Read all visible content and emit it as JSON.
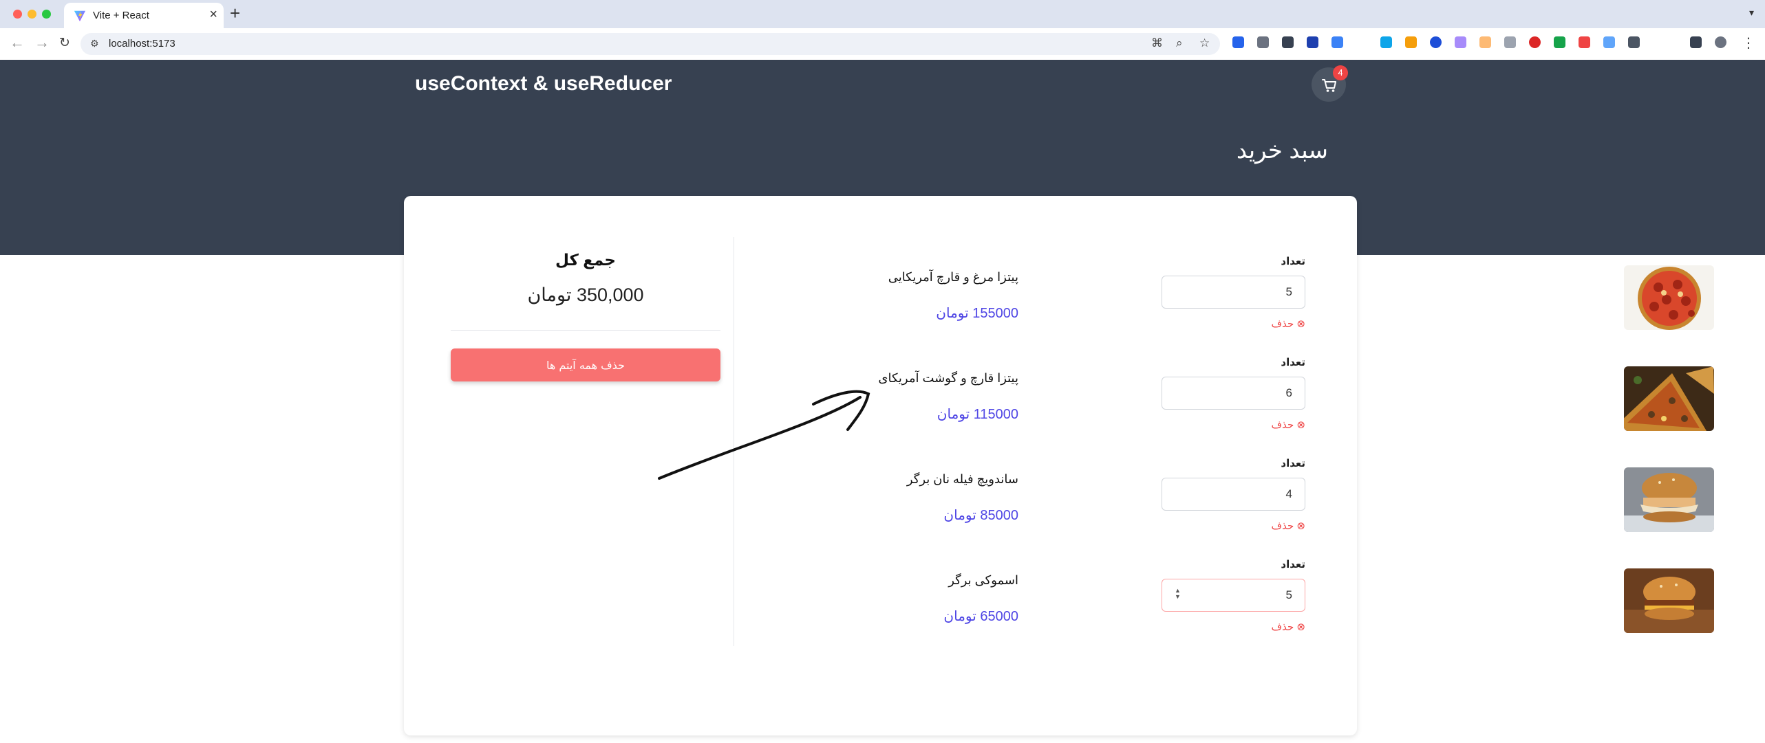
{
  "browser": {
    "tab_title": "Vite + React",
    "url": "localhost:5173"
  },
  "header": {
    "brand": "useContext & useReducer",
    "cart_count": "4"
  },
  "page": {
    "title": "سبد خرید"
  },
  "summary": {
    "title": "جمع کل",
    "total": "350,000 تومان",
    "clear_all_label": "حذف همه آیتم ها"
  },
  "items": [
    {
      "name": "پیتزا مرغ و قارچ آمریکایی",
      "price": "155000 تومان",
      "qty_label": "تعداد",
      "quantity": "5",
      "delete_label": "حذف",
      "image": "pepperoni-pizza"
    },
    {
      "name": "پیتزا قارچ و گوشت آمریکای",
      "price": "115000 تومان",
      "qty_label": "تعداد",
      "quantity": "6",
      "delete_label": "حذف",
      "image": "meat-pizza-slice"
    },
    {
      "name": "ساندویچ فیله نان برگر",
      "price": "85000 تومان",
      "qty_label": "تعداد",
      "quantity": "4",
      "delete_label": "حذف",
      "image": "chicken-burger"
    },
    {
      "name": "اسموکی برگر",
      "price": "65000 تومان",
      "qty_label": "تعداد",
      "quantity": "5",
      "delete_label": "حذف",
      "image": "smoky-burger"
    }
  ],
  "colors": {
    "header_bg": "#374151",
    "price": "#4f46e5",
    "danger": "#ef4444",
    "clear_button": "#f87171"
  }
}
